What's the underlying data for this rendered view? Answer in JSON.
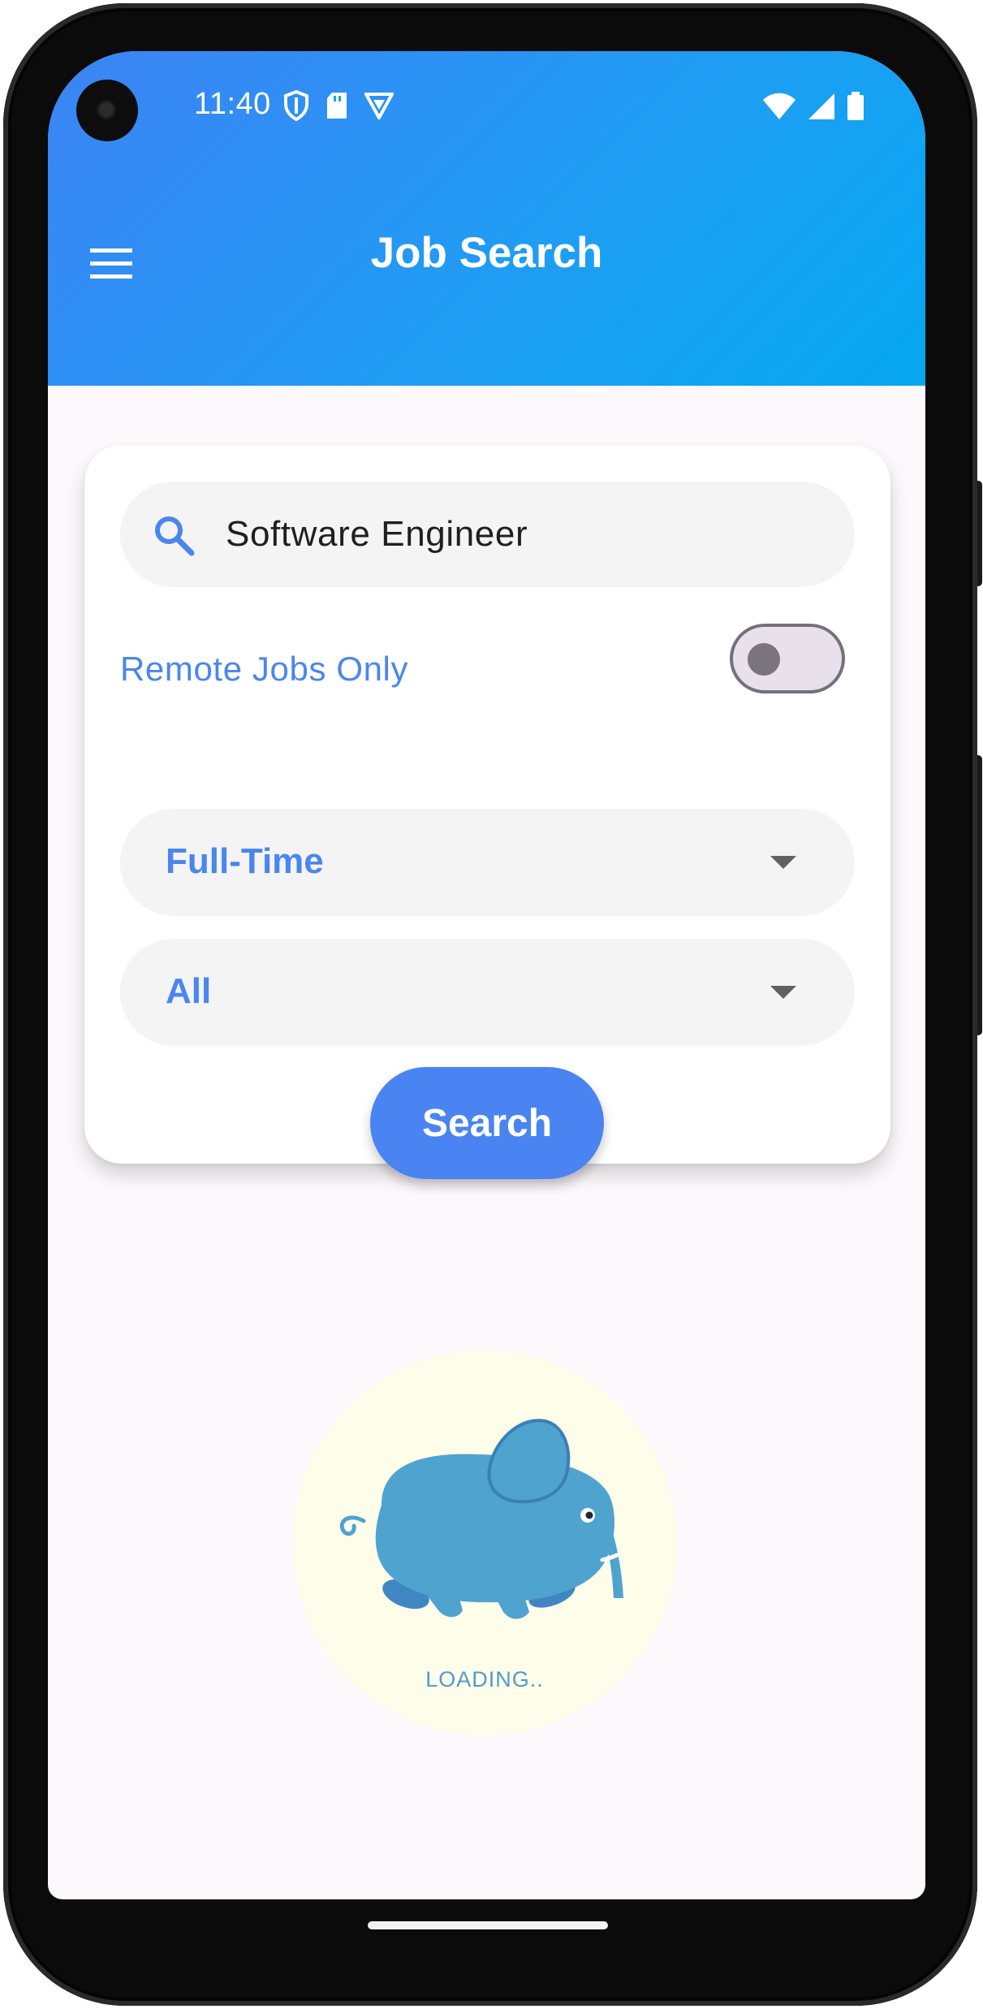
{
  "status_bar": {
    "time": "11:40"
  },
  "app_bar": {
    "title": "Job Search"
  },
  "search": {
    "query": "Software Engineer"
  },
  "filters": {
    "remote_label": "Remote Jobs Only",
    "remote_enabled": false,
    "job_type_selected": "Full-Time",
    "category_selected": "All"
  },
  "actions": {
    "search_label": "Search"
  },
  "loader": {
    "text": "LOADING.."
  },
  "colors": {
    "accent": "#4a86ef",
    "appbar_start": "#3d83f5",
    "appbar_end": "#06a8f0",
    "elephant": "#4fa3cf"
  }
}
